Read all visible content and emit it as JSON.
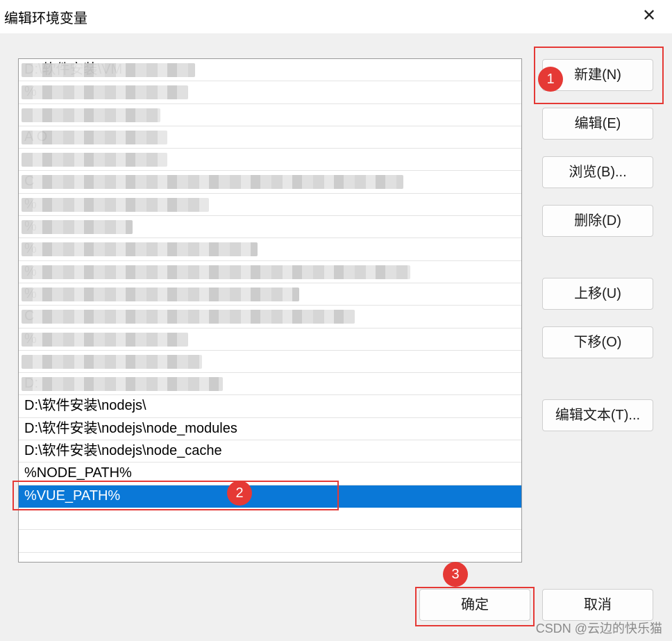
{
  "window": {
    "title": "编辑环境变量",
    "close_label": "✕"
  },
  "path_list": {
    "entries": [
      {
        "text": "D:\\软件安装\\VM",
        "obscured": true
      },
      {
        "text": "%",
        "obscured": true
      },
      {
        "text": "",
        "obscured": true
      },
      {
        "text": "A O",
        "obscured": true
      },
      {
        "text": "",
        "obscured": true
      },
      {
        "text": "C",
        "obscured": true
      },
      {
        "text": "%",
        "obscured": true
      },
      {
        "text": "%",
        "obscured": true
      },
      {
        "text": "%",
        "obscured": true
      },
      {
        "text": "%",
        "obscured": true
      },
      {
        "text": "%",
        "obscured": true
      },
      {
        "text": "C",
        "obscured": true
      },
      {
        "text": "%",
        "obscured": true
      },
      {
        "text": "",
        "obscured": true
      },
      {
        "text": "D:",
        "obscured": true
      },
      {
        "text": "D:\\软件安装\\nodejs\\",
        "obscured": false
      },
      {
        "text": "D:\\软件安装\\nodejs\\node_modules",
        "obscured": false
      },
      {
        "text": "D:\\软件安装\\nodejs\\node_cache",
        "obscured": false
      },
      {
        "text": "%NODE_PATH%",
        "obscured": false
      },
      {
        "text": "%VUE_PATH%",
        "obscured": false,
        "selected": true
      },
      {
        "text": "",
        "obscured": false
      },
      {
        "text": "",
        "obscured": false
      }
    ]
  },
  "buttons": {
    "new": "新建(N)",
    "edit": "编辑(E)",
    "browse": "浏览(B)...",
    "delete": "删除(D)",
    "move_up": "上移(U)",
    "move_down": "下移(O)",
    "edit_text": "编辑文本(T)...",
    "ok": "确定",
    "cancel": "取消"
  },
  "annotations": {
    "step1": "1",
    "step2": "2",
    "step3": "3"
  },
  "watermark": "CSDN @云边的快乐猫",
  "colors": {
    "selection": "#0a78d7",
    "highlight": "#e53935"
  }
}
